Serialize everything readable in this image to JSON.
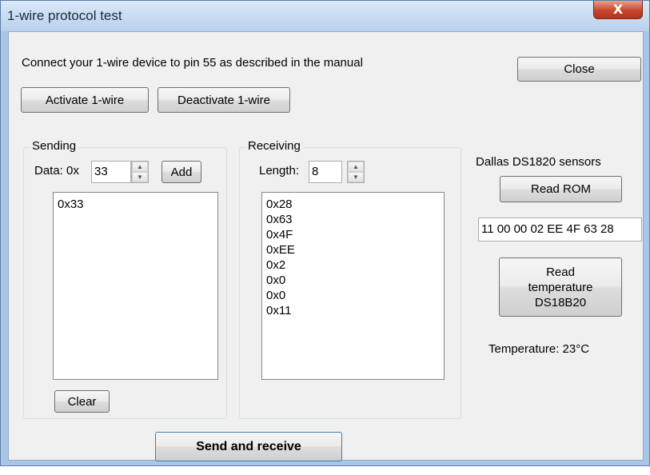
{
  "window": {
    "title": "1-wire protocol test",
    "close_glyph": "X"
  },
  "instructions": "Connect your 1-wire device to pin 55 as described in the manual",
  "buttons": {
    "activate": "Activate 1-wire",
    "deactivate": "Deactivate 1-wire",
    "close": "Close",
    "add": "Add",
    "clear": "Clear",
    "send_receive": "Send and receive",
    "read_rom": "Read ROM",
    "read_temperature": "Read temperature DS18B20"
  },
  "sending": {
    "title": "Sending",
    "data_label": "Data: 0x",
    "data_value": "33",
    "items": [
      "0x33"
    ]
  },
  "receiving": {
    "title": "Receiving",
    "length_label": "Length:",
    "length_value": "8",
    "items": [
      "0x28",
      "0x63",
      "0x4F",
      "0xEE",
      "0x2",
      "0x0",
      "0x0",
      "0x11"
    ]
  },
  "dallas": {
    "heading": "Dallas DS1820 sensors",
    "rom_value": "11 00 00 02 EE 4F 63 28",
    "temperature_text": "Temperature: 23°C"
  },
  "icons": {
    "spin_up": "up-arrow-icon",
    "spin_down": "down-arrow-icon"
  }
}
